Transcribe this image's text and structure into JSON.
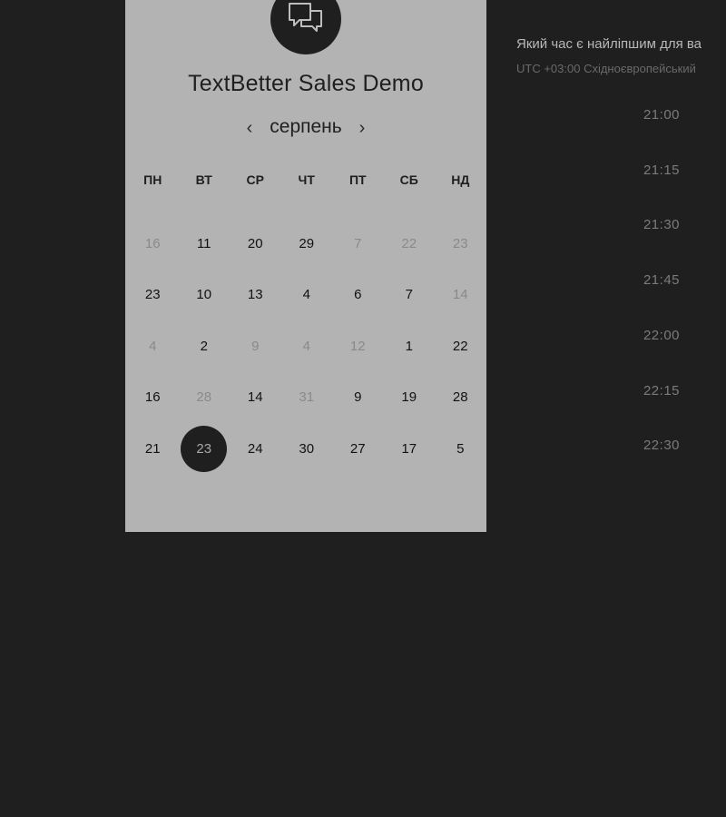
{
  "widget": {
    "title": "TextBetter Sales Demo",
    "logo_icon": "chat-bubbles-icon"
  },
  "calendar": {
    "month": "серпень",
    "prev_icon": "chevron-left-icon",
    "next_icon": "chevron-right-icon",
    "weekdays": [
      "ПН",
      "ВТ",
      "СР",
      "ЧТ",
      "ПТ",
      "СБ",
      "НД"
    ],
    "days": [
      {
        "label": "16",
        "disabled": true
      },
      {
        "label": "11",
        "disabled": false
      },
      {
        "label": "20",
        "disabled": false
      },
      {
        "label": "29",
        "disabled": false
      },
      {
        "label": "7",
        "disabled": true
      },
      {
        "label": "22",
        "disabled": true
      },
      {
        "label": "23",
        "disabled": true
      },
      {
        "label": "23",
        "disabled": false
      },
      {
        "label": "10",
        "disabled": false
      },
      {
        "label": "13",
        "disabled": false
      },
      {
        "label": "4",
        "disabled": false
      },
      {
        "label": "6",
        "disabled": false
      },
      {
        "label": "7",
        "disabled": false
      },
      {
        "label": "14",
        "disabled": true
      },
      {
        "label": "4",
        "disabled": true
      },
      {
        "label": "2",
        "disabled": false
      },
      {
        "label": "9",
        "disabled": true
      },
      {
        "label": "4",
        "disabled": true
      },
      {
        "label": "12",
        "disabled": true
      },
      {
        "label": "1",
        "disabled": false
      },
      {
        "label": "22",
        "disabled": false
      },
      {
        "label": "16",
        "disabled": false
      },
      {
        "label": "28",
        "disabled": true
      },
      {
        "label": "14",
        "disabled": false
      },
      {
        "label": "31",
        "disabled": true
      },
      {
        "label": "9",
        "disabled": false
      },
      {
        "label": "19",
        "disabled": false
      },
      {
        "label": "28",
        "disabled": false
      },
      {
        "label": "21",
        "disabled": false
      },
      {
        "label": "23",
        "disabled": false,
        "selected": true
      },
      {
        "label": "24",
        "disabled": false
      },
      {
        "label": "30",
        "disabled": false
      },
      {
        "label": "27",
        "disabled": false
      },
      {
        "label": "17",
        "disabled": false
      },
      {
        "label": "5",
        "disabled": false
      }
    ]
  },
  "times": {
    "question": "Який час є найліпшим для ва",
    "timezone": "UTC +03:00 Східноєвропейський",
    "slots": [
      "21:00",
      "21:15",
      "21:30",
      "21:45",
      "22:00",
      "22:15",
      "22:30"
    ]
  },
  "colors": {
    "background": "#1f1f1f",
    "panel": "#b3b3b3",
    "selected_day": "#1f1f1f"
  }
}
